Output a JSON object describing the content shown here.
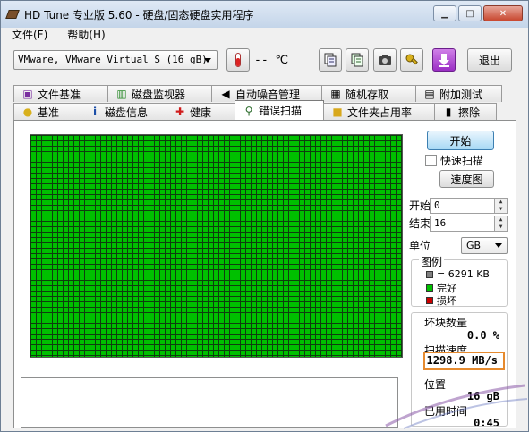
{
  "window": {
    "title": "HD Tune 专业版 5.60 - 硬盘/固态硬盘实用程序",
    "minimize": "▁",
    "maximize": "□",
    "close": "✕"
  },
  "menu": [
    {
      "label": "文件(F)"
    },
    {
      "label": "帮助(H)"
    }
  ],
  "toolbar": {
    "drive": "VMware, VMware Virtual S (16 gB)",
    "temperature": "-- ℃",
    "exit_label": "退出"
  },
  "tabs_top": [
    {
      "label": "文件基准",
      "icon": "file-benchmark-icon"
    },
    {
      "label": "磁盘监视器",
      "icon": "disk-monitor-icon"
    },
    {
      "label": "自动噪音管理",
      "icon": "speaker-icon"
    },
    {
      "label": "随机存取",
      "icon": "random-access-icon"
    },
    {
      "label": "附加测试",
      "icon": "extra-tests-icon"
    }
  ],
  "tabs_bottom": [
    {
      "label": "基准",
      "icon": "lightbulb-icon"
    },
    {
      "label": "磁盘信息",
      "icon": "info-icon"
    },
    {
      "label": "健康",
      "icon": "health-cross-icon"
    },
    {
      "label": "错误扫描",
      "icon": "magnifier-icon"
    },
    {
      "label": "文件夹占用率",
      "icon": "folder-icon"
    },
    {
      "label": "擦除",
      "icon": "trash-icon"
    }
  ],
  "active_tab": "错误扫描",
  "scan": {
    "start_button": "开始",
    "quick_scan_label": "快速扫描",
    "quick_scan_checked": false,
    "speed_map_button": "速度图",
    "start_label": "开始",
    "start_value": "0",
    "end_label": "结束",
    "end_value": "16",
    "unit_label": "单位",
    "unit_value": "GB"
  },
  "legend": {
    "title": "图例",
    "block_size": "= 6291 KB",
    "good": "完好",
    "damaged": "损坏",
    "colors": {
      "block": "#808080",
      "good": "#00c000",
      "damaged": "#cc0000"
    }
  },
  "stats": {
    "bad_blocks_label": "坏块数量",
    "bad_blocks_value": "0.0 %",
    "scan_speed_label": "扫描速度",
    "scan_speed_value": "1298.9 MB/s",
    "position_label": "位置",
    "position_value": "16 gB",
    "elapsed_label": "已用时间",
    "elapsed_value": "0:45"
  },
  "colors": {
    "grid_good": "#00c000",
    "highlight": "#e68a2e"
  }
}
